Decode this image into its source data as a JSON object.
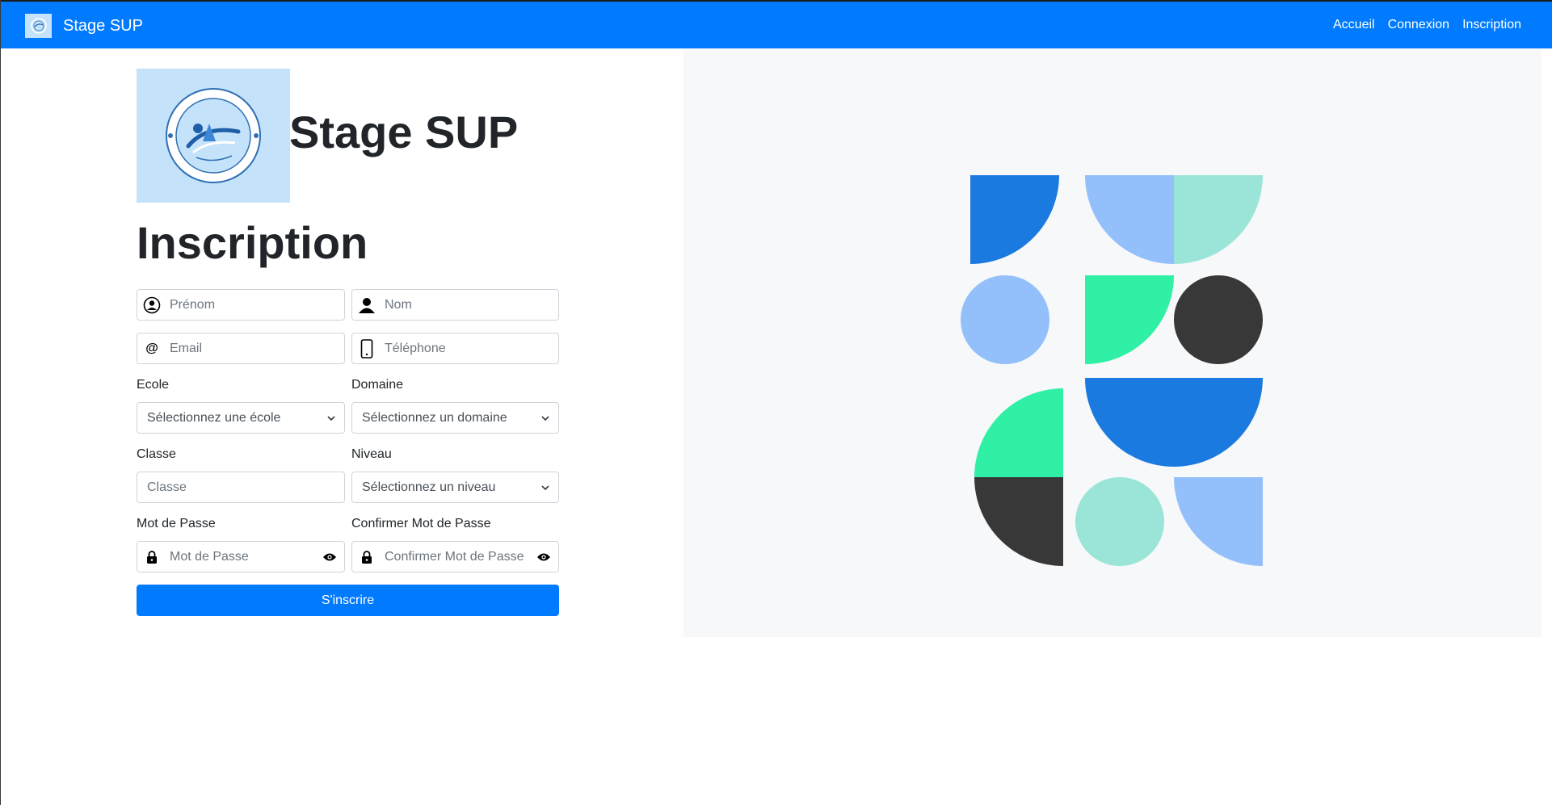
{
  "navbar": {
    "brand": "Stage SUP",
    "links": [
      "Accueil",
      "Connexion",
      "Inscription"
    ]
  },
  "header": {
    "site_title": "Stage SUP",
    "page_title": "Inscription"
  },
  "form": {
    "prenom_placeholder": "Prénom",
    "nom_placeholder": "Nom",
    "email_placeholder": "Email",
    "telephone_placeholder": "Téléphone",
    "ecole_label": "Ecole",
    "ecole_value": "Sélectionnez une école",
    "domaine_label": "Domaine",
    "domaine_value": "Sélectionnez un domaine",
    "classe_label": "Classe",
    "classe_placeholder": "Classe",
    "niveau_label": "Niveau",
    "niveau_value": "Sélectionnez un niveau",
    "password_label": "Mot de Passe",
    "password_placeholder": "Mot de Passe",
    "confirm_label": "Confirmer Mot de Passe",
    "confirm_placeholder": "Confirmer Mot de Passe",
    "submit_label": "S'inscrire"
  },
  "colors": {
    "primary": "#007bff",
    "logo_bg": "#c4e3fb",
    "art_blue": "#1b7ae0",
    "art_light_blue": "#93c0fa",
    "art_mint": "#9ae5d8",
    "art_green": "#30f0a5",
    "art_dark": "#383838"
  },
  "icons": {
    "user_circle": "user-circle-icon",
    "user": "user-icon",
    "at": "at-icon",
    "phone": "phone-icon",
    "lock": "lock-icon",
    "eye": "eye-icon",
    "chevron": "chevron-down-icon"
  }
}
